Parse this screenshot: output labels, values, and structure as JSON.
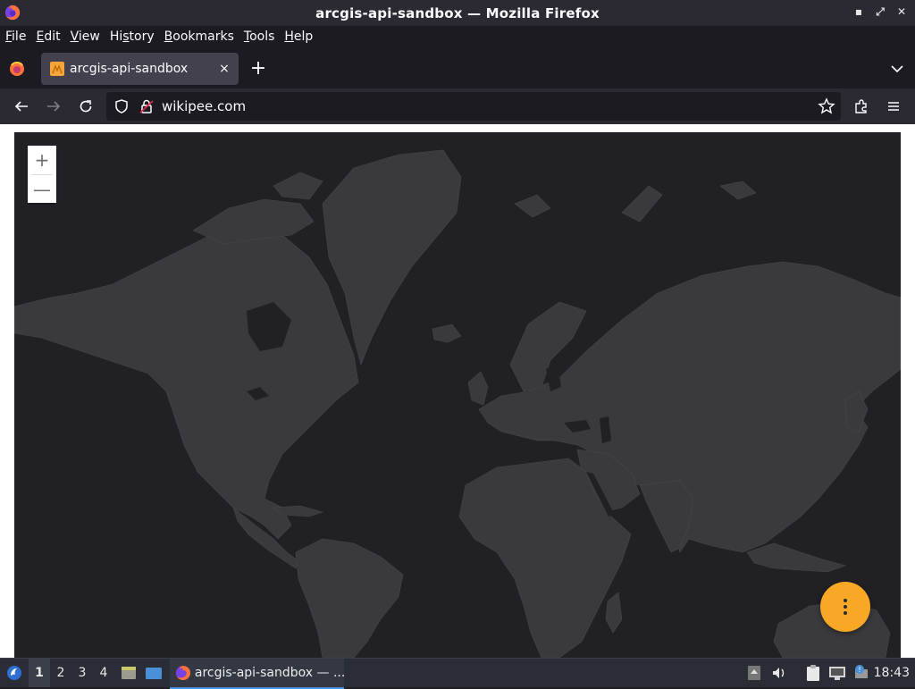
{
  "window": {
    "title": "arcgis-api-sandbox — Mozilla Firefox",
    "controls": [
      "minimize",
      "maximize",
      "close"
    ]
  },
  "menubar": {
    "items": [
      {
        "label": "File",
        "accel": "F"
      },
      {
        "label": "Edit",
        "accel": "E"
      },
      {
        "label": "View",
        "accel": "V"
      },
      {
        "label": "History",
        "accel": "s"
      },
      {
        "label": "Bookmarks",
        "accel": "B"
      },
      {
        "label": "Tools",
        "accel": "T"
      },
      {
        "label": "Help",
        "accel": "H"
      }
    ]
  },
  "tabs": {
    "active": {
      "title": "arcgis-api-sandbox",
      "close_symbol": "×"
    },
    "new_tab_symbol": "+"
  },
  "navbar": {
    "url": "wikipee.com"
  },
  "map": {
    "zoom_in": "+",
    "zoom_out": "—",
    "colors": {
      "water": "#202025",
      "land": "#3a3a3e",
      "fab": "#f9a826"
    }
  },
  "taskbar": {
    "workspaces": [
      "1",
      "2",
      "3",
      "4"
    ],
    "active_workspace": "1",
    "task_label": "arcgis-api-sandbox — ...",
    "clock": "18:43"
  }
}
